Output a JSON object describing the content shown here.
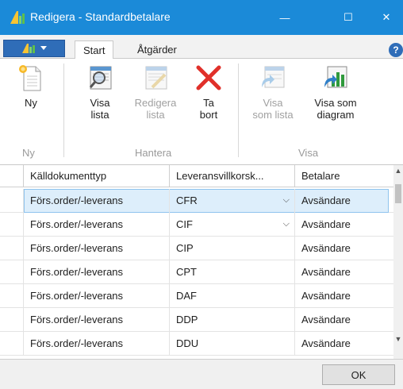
{
  "window": {
    "title": "Redigera - Standardbetalare",
    "minimize_glyph": "—",
    "maximize_glyph": "☐",
    "close_glyph": "✕"
  },
  "ribbon_tabs": {
    "start": "Start",
    "atgarder": "Åtgärder",
    "help_glyph": "?"
  },
  "ribbon": {
    "ny": {
      "label": "Ny",
      "icon": "new-document-icon"
    },
    "visa_lista": {
      "label_1": "Visa",
      "label_2": "lista",
      "icon": "view-list-icon"
    },
    "redigera_lista": {
      "label_1": "Redigera",
      "label_2": "lista",
      "icon": "edit-list-icon",
      "disabled": true
    },
    "ta_bort": {
      "label_1": "Ta",
      "label_2": "bort",
      "icon": "delete-x-icon"
    },
    "visa_som_lista": {
      "label_1": "Visa",
      "label_2": "som lista",
      "icon": "show-as-list-icon",
      "disabled": true
    },
    "visa_som_diagram": {
      "label_1": "Visa som",
      "label_2": "diagram",
      "icon": "show-as-chart-icon"
    },
    "groups": {
      "ny": "Ny",
      "hantera": "Hantera",
      "visa": "Visa"
    }
  },
  "grid": {
    "columns": [
      "Källdokumenttyp",
      "Leveransvillkorsk...",
      "Betalare"
    ],
    "rows": [
      {
        "source": "Förs.order/-leverans",
        "terms": "CFR",
        "payer": "Avsändare",
        "dropdown": true,
        "active": true
      },
      {
        "source": "Förs.order/-leverans",
        "terms": "CIF",
        "payer": "Avsändare",
        "dropdown": true,
        "active": false
      },
      {
        "source": "Förs.order/-leverans",
        "terms": "CIP",
        "payer": "Avsändare",
        "dropdown": false,
        "active": false
      },
      {
        "source": "Förs.order/-leverans",
        "terms": "CPT",
        "payer": "Avsändare",
        "dropdown": false,
        "active": false
      },
      {
        "source": "Förs.order/-leverans",
        "terms": "DAF",
        "payer": "Avsändare",
        "dropdown": false,
        "active": false
      },
      {
        "source": "Förs.order/-leverans",
        "terms": "DDP",
        "payer": "Avsändare",
        "dropdown": false,
        "active": false
      },
      {
        "source": "Förs.order/-leverans",
        "terms": "DDU",
        "payer": "Avsändare",
        "dropdown": false,
        "active": false
      }
    ]
  },
  "footer": {
    "ok_label": "OK"
  },
  "colors": {
    "titlebar": "#1b8ad8",
    "accent": "#2f6db8",
    "selection": "#ddeefb"
  }
}
